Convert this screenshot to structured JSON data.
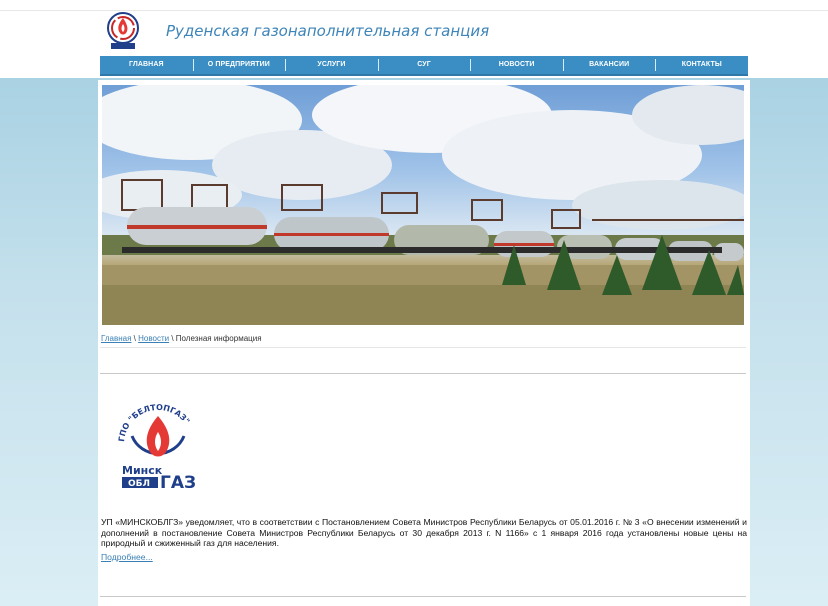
{
  "header": {
    "site_title": "Руденская газонаполнительная станция"
  },
  "nav": {
    "items": [
      {
        "label": "ГЛАВНАЯ"
      },
      {
        "label": "О ПРЕДПРИЯТИИ"
      },
      {
        "label": "УСЛУГИ"
      },
      {
        "label": "СУГ"
      },
      {
        "label": "НОВОСТИ"
      },
      {
        "label": "ВАКАНСИИ"
      },
      {
        "label": "КОНТАКТЫ"
      }
    ]
  },
  "breadcrumb": {
    "home": "Главная",
    "sep1": " \\ ",
    "news": "Новости",
    "sep2": " \\ ",
    "current": "Полезная информация"
  },
  "news": {
    "logo_arc_text": "ГПО \"БЕЛТОПГАЗ\"",
    "logo_word_minsk": "Минск",
    "logo_word_obl": "ОБЛ",
    "logo_word_gaz": "ГАЗ",
    "text": "УП «МИНСКОБЛГЗ» уведомляет, что в соответствии с Постановлением Совета Министров Республики Беларусь от 05.01.2016 г. № 3 «О внесении изменений и дополнений в постановление Совета Министров Республики Беларусь от 30 декабря 2013 г. N 1166» с 1 января 2016 года установлены новые цены на природный и сжиженный газ для населения.",
    "more": "Подробнее..."
  },
  "colors": {
    "nav_bg": "#3a8ec4",
    "title": "#3d84b8",
    "link": "#3a7fb5",
    "band_top": "#a9d2e3"
  }
}
